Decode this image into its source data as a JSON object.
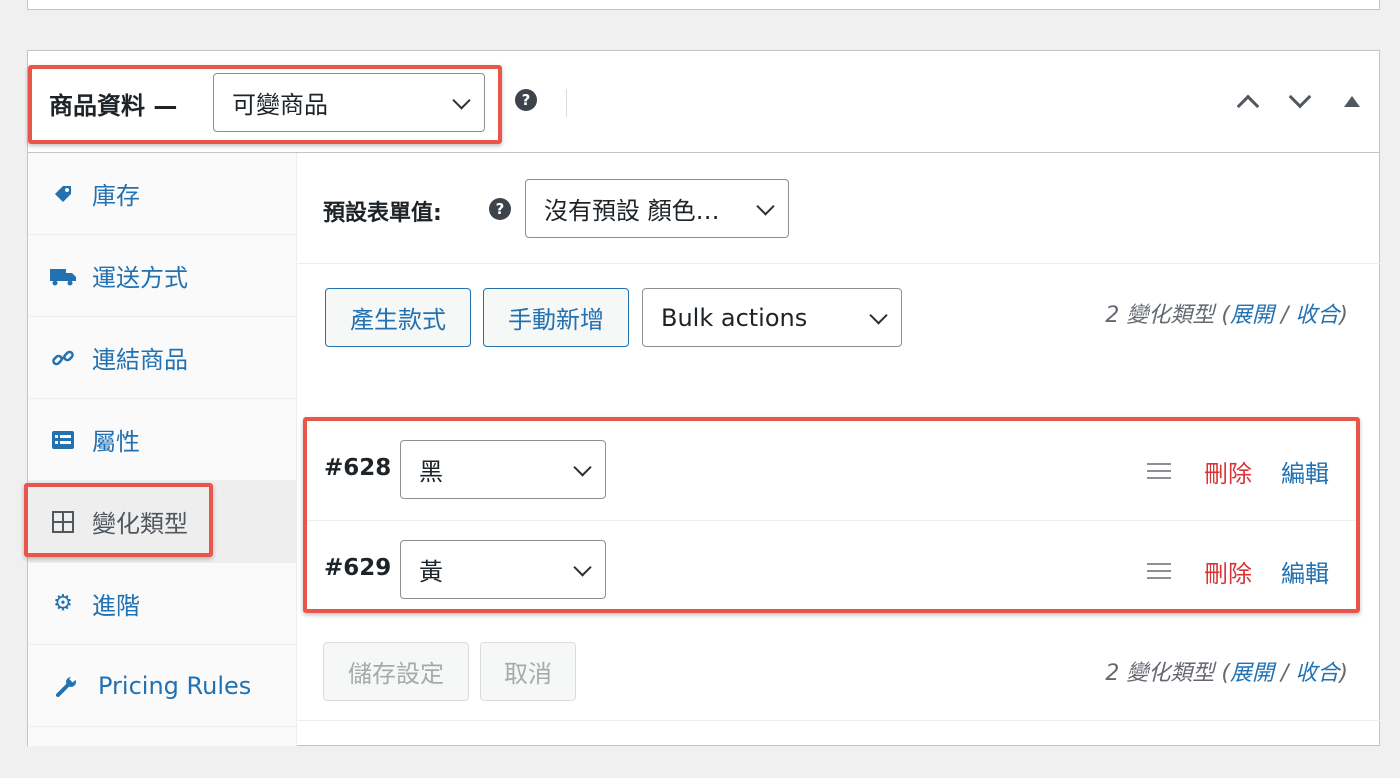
{
  "header": {
    "title": "商品資料 —",
    "product_type": "可變商品",
    "help_symbol": "?"
  },
  "sidebar": {
    "items": [
      {
        "label": "庫存",
        "icon": "tag-icon"
      },
      {
        "label": "運送方式",
        "icon": "truck-icon"
      },
      {
        "label": "連結商品",
        "icon": "link-icon"
      },
      {
        "label": "屬性",
        "icon": "list-icon"
      },
      {
        "label": "變化類型",
        "icon": "grid-icon",
        "active": true
      },
      {
        "label": "進階",
        "icon": "gear-icon"
      },
      {
        "label": "Pricing Rules",
        "icon": "wrench-icon"
      }
    ]
  },
  "defaults": {
    "label": "預設表單值:",
    "select_value": "沒有預設 顏色…"
  },
  "toolbar": {
    "generate_label": "產生款式",
    "add_label": "手動新增",
    "bulk_value": "Bulk actions"
  },
  "counts": {
    "prefix": "2 變化類型 (",
    "expand": "展開",
    "slash": " / ",
    "collapse": "收合",
    "suffix": ")"
  },
  "variations": [
    {
      "id": "#628",
      "value": "黑",
      "delete_label": "刪除",
      "edit_label": "編輯"
    },
    {
      "id": "#629",
      "value": "黃",
      "delete_label": "刪除",
      "edit_label": "編輯"
    }
  ],
  "footer": {
    "save_label": "儲存設定",
    "cancel_label": "取消"
  },
  "colors": {
    "highlight": "#e8564b",
    "link": "#2271b1",
    "delete": "#d63638"
  }
}
